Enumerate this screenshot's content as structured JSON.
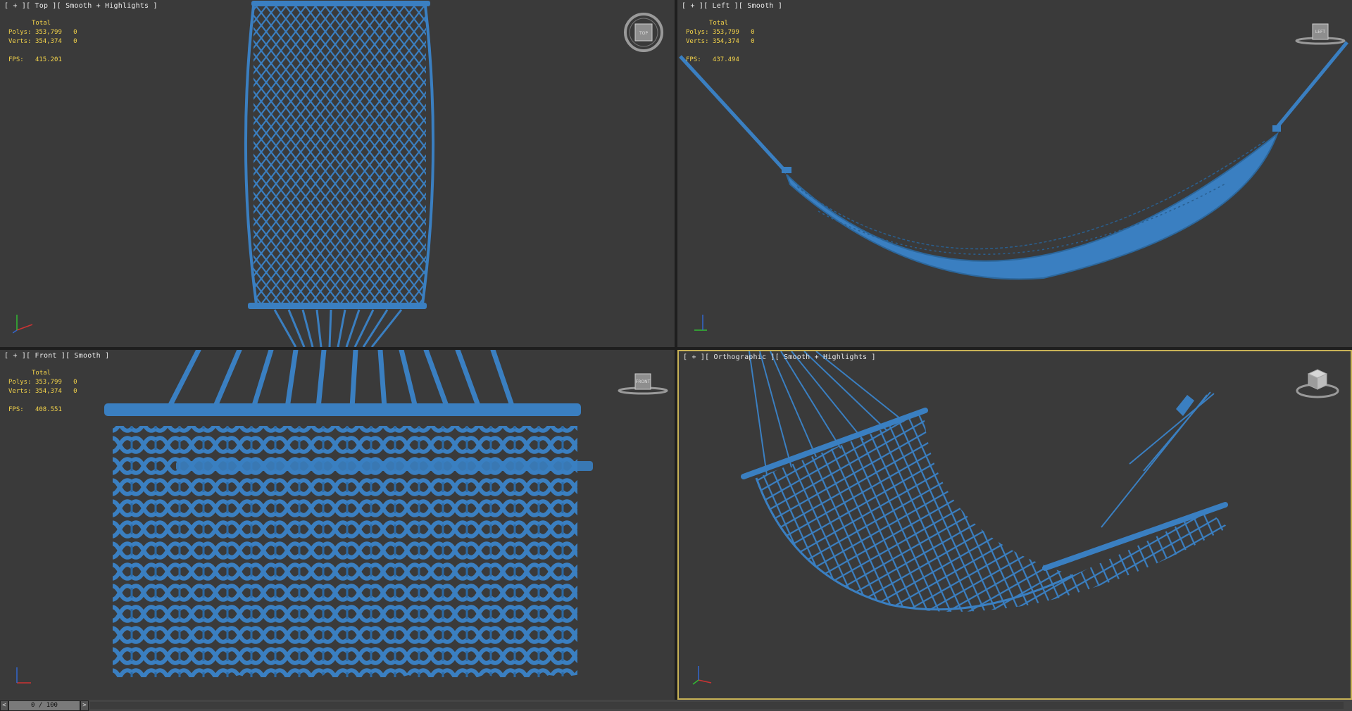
{
  "viewports": {
    "top": {
      "label": "[ + ][ Top ][ Smooth + Highlights ]",
      "stats": {
        "total": "Total",
        "polys_label": "Polys:",
        "polys": "353,799",
        "polys_sel": "0",
        "verts_label": "Verts:",
        "verts": "354,374",
        "verts_sel": "0",
        "fps_label": "FPS:",
        "fps": "415.201"
      },
      "viewcube": "TOP"
    },
    "left": {
      "label": "[ + ][ Left ][ Smooth ]",
      "stats": {
        "total": "Total",
        "polys_label": "Polys:",
        "polys": "353,799",
        "polys_sel": "0",
        "verts_label": "Verts:",
        "verts": "354,374",
        "verts_sel": "0",
        "fps_label": "FPS:",
        "fps": "437.494"
      },
      "viewcube": "LEFT"
    },
    "front": {
      "label": "[ + ][ Front ][ Smooth ]",
      "stats": {
        "total": "Total",
        "polys_label": "Polys:",
        "polys": "353,799",
        "polys_sel": "0",
        "verts_label": "Verts:",
        "verts": "354,374",
        "verts_sel": "0",
        "fps_label": "FPS:",
        "fps": "408.551"
      },
      "viewcube": "FRONT"
    },
    "persp": {
      "label": "[ + ][ Orthographic ][ Smooth + Highlights ]"
    }
  },
  "timeline": {
    "prev": "<",
    "next": ">",
    "frame": "0 / 100"
  },
  "colors": {
    "viewport_bg": "#3a3a3a",
    "mesh": "#3a7fc1",
    "active_border": "#c8b256",
    "stats_text": "#f3d34a"
  }
}
